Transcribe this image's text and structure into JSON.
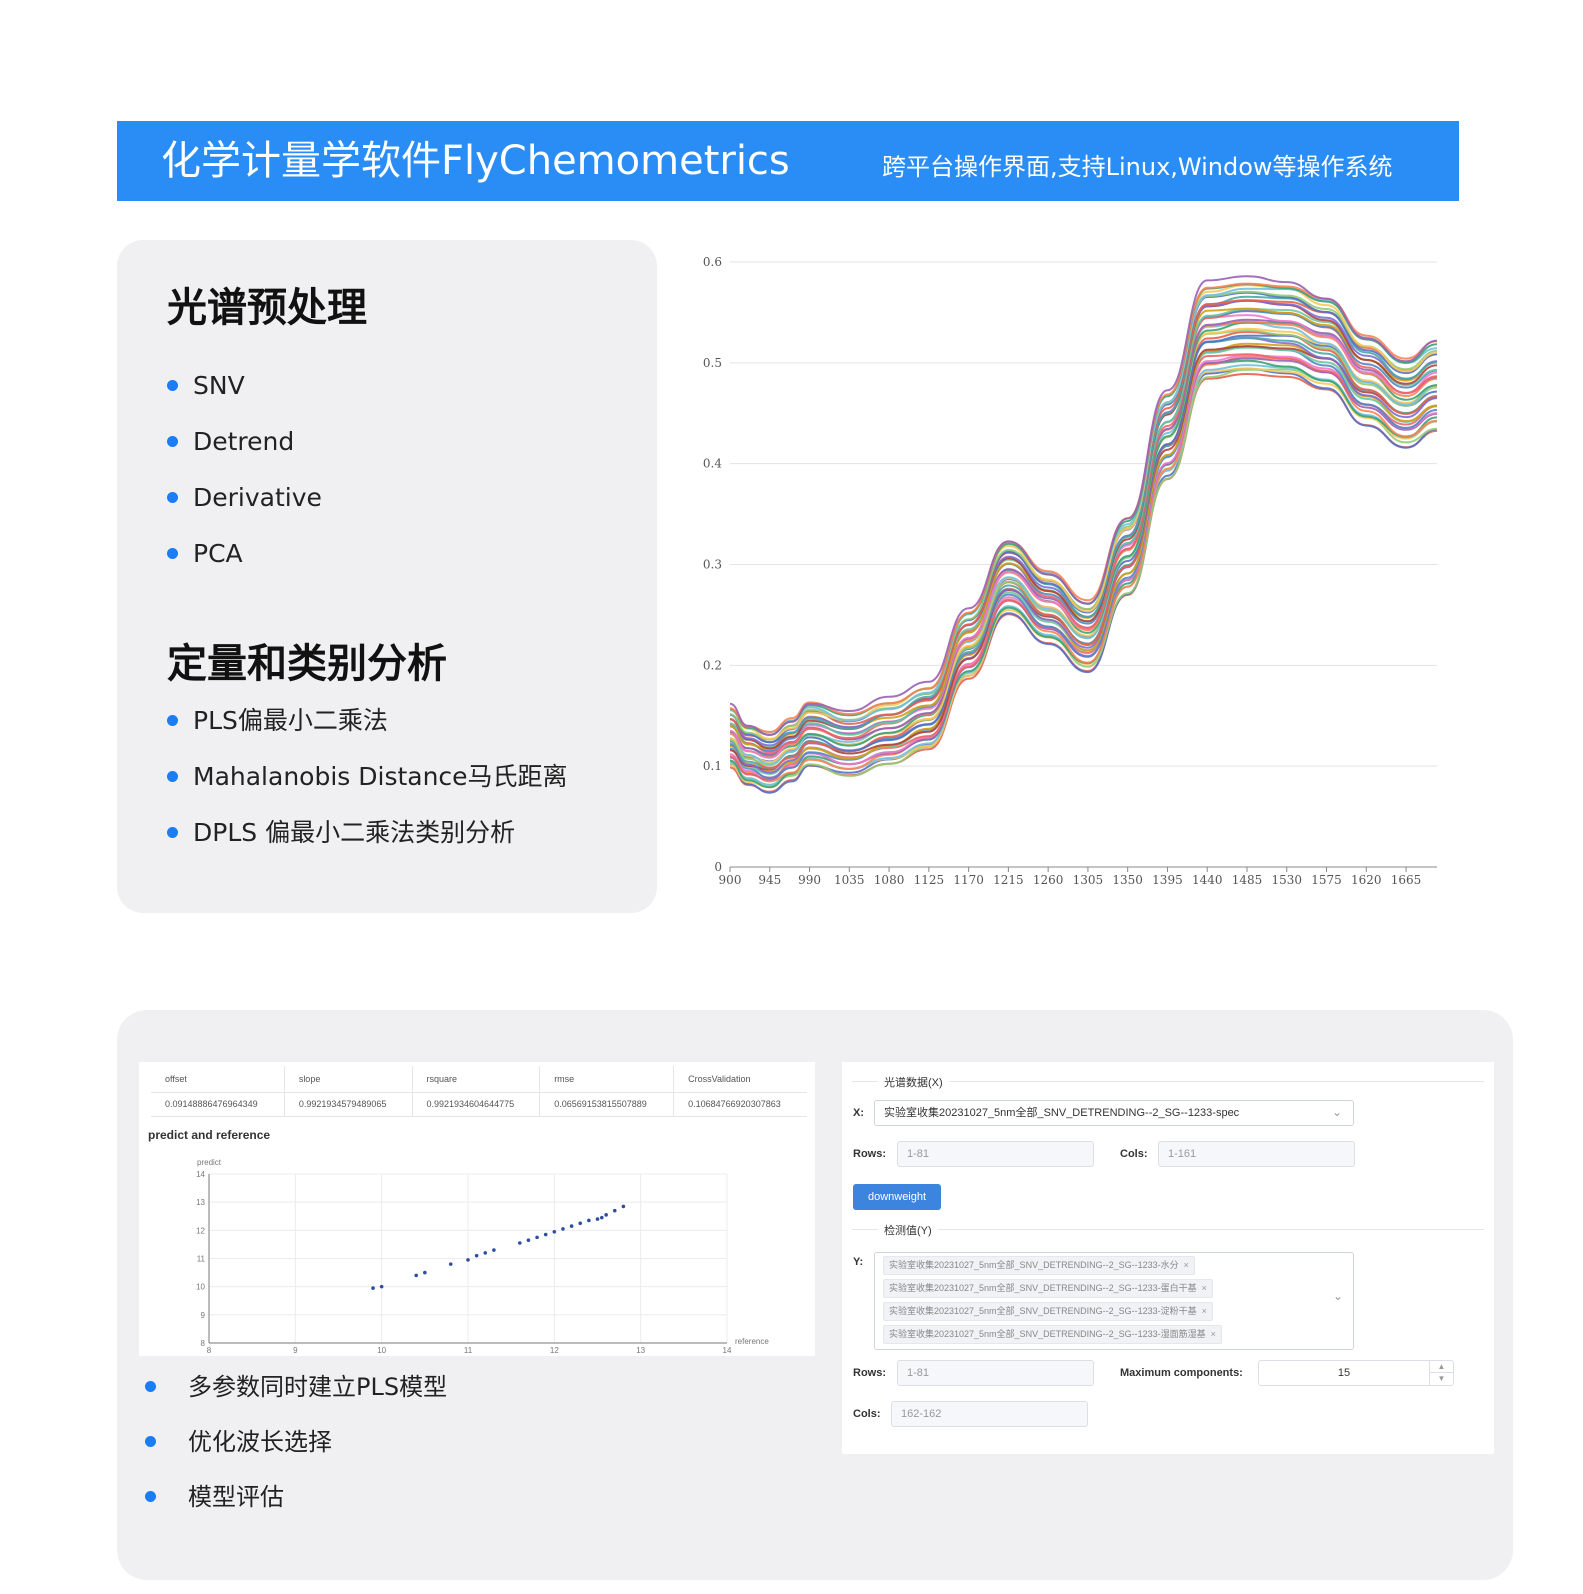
{
  "banner": {
    "title": "化学计量学软件FlyChemometrics",
    "subtitle": "跨平台操作界面,支持Linux,Window等操作系统"
  },
  "preprocessing": {
    "title": "光谱预处理",
    "items": [
      "SNV",
      "Detrend",
      "Derivative",
      "PCA"
    ]
  },
  "analysis": {
    "title": "定量和类别分析",
    "items": [
      "PLS偏最小二乘法",
      "Mahalanobis Distance马氏距离",
      "DPLS 偏最小二乘法类别分析"
    ]
  },
  "chart_data": [
    {
      "type": "line",
      "title": "",
      "xlabel": "",
      "ylabel": "",
      "x_ticks": [
        900,
        945,
        990,
        1035,
        1080,
        1125,
        1170,
        1215,
        1260,
        1305,
        1350,
        1395,
        1440,
        1485,
        1530,
        1575,
        1620,
        1665
      ],
      "y_ticks": [
        0,
        0.1,
        0.2,
        0.3,
        0.4,
        0.5,
        0.6
      ],
      "xlim": [
        900,
        1700
      ],
      "ylim": [
        0,
        0.6
      ],
      "grid": "horizontal",
      "x": [
        900,
        920,
        945,
        970,
        990,
        1035,
        1080,
        1125,
        1170,
        1215,
        1260,
        1305,
        1350,
        1395,
        1440,
        1485,
        1530,
        1575,
        1620,
        1665,
        1700
      ],
      "base_profile": [
        0.133,
        0.115,
        0.108,
        0.12,
        0.135,
        0.125,
        0.137,
        0.152,
        0.225,
        0.292,
        0.262,
        0.233,
        0.312,
        0.432,
        0.536,
        0.541,
        0.538,
        0.525,
        0.488,
        0.465,
        0.482
      ],
      "series_count": 40,
      "series_spread": [
        -0.052,
        0.042
      ],
      "series_colors": [
        "#e8604c",
        "#5470c6",
        "#91cc75",
        "#fac858",
        "#73c0de",
        "#3ba272",
        "#fc8452",
        "#9a60b4",
        "#ea7ccc",
        "#ee6666",
        "#4f88c8",
        "#6dc8a0",
        "#d4a017",
        "#b0413e",
        "#7b6ed6",
        "#48a9a6"
      ]
    },
    {
      "type": "scatter",
      "title": "predict and reference",
      "xlabel": "reference",
      "ylabel": "predict",
      "xlim": [
        8,
        14
      ],
      "ylim": [
        8,
        14
      ],
      "x_ticks": [
        8,
        9,
        10,
        11,
        12,
        13,
        14
      ],
      "y_ticks": [
        8,
        9,
        10,
        11,
        12,
        13,
        14
      ],
      "x": [
        9.9,
        10.0,
        10.4,
        10.5,
        10.8,
        11.0,
        11.1,
        11.2,
        11.3,
        11.6,
        11.7,
        11.8,
        11.9,
        12.0,
        12.1,
        12.2,
        12.3,
        12.4,
        12.5,
        12.55,
        12.6,
        12.7,
        12.8
      ],
      "y": [
        9.95,
        10.0,
        10.4,
        10.5,
        10.8,
        10.95,
        11.1,
        11.2,
        11.3,
        11.55,
        11.65,
        11.75,
        11.85,
        11.95,
        12.05,
        12.15,
        12.25,
        12.35,
        12.4,
        12.45,
        12.55,
        12.7,
        12.85
      ],
      "point_color": "#2f4ea0"
    }
  ],
  "metrics": {
    "headers": [
      "offset",
      "slope",
      "rsquare",
      "rmse",
      "CrossValidation"
    ],
    "values": [
      "0.09148886476964349",
      "0.9921934579489065",
      "0.9921934604644775",
      "0.06569153815507889",
      "0.10684766920307863"
    ]
  },
  "form": {
    "x_section": "光谱数据(X)",
    "x_label": "X:",
    "x_value": "实验室收集20231027_5nm全部_SNV_DETRENDING--2_SG--1233-spec",
    "rows_label": "Rows:",
    "rows_value": "1-81",
    "cols_label": "Cols:",
    "cols_value": "1-161",
    "button": "downweight",
    "y_section": "检测值(Y)",
    "y_label": "Y:",
    "y_tags": [
      "实验室收集20231027_5nm全部_SNV_DETRENDING--2_SG--1233-水分",
      "实验室收集20231027_5nm全部_SNV_DETRENDING--2_SG--1233-蛋白干基",
      "实验室收集20231027_5nm全部_SNV_DETRENDING--2_SG--1233-淀粉干基",
      "实验室收集20231027_5nm全部_SNV_DETRENDING--2_SG--1233-湿面筋湿基"
    ],
    "rows2_label": "Rows:",
    "rows2_value": "1-81",
    "maxcomp_label": "Maximum components:",
    "maxcomp_value": "15",
    "cols2_label": "Cols:",
    "cols2_value": "162-162"
  },
  "bottom_features": [
    "多参数同时建立PLS模型",
    "优化波长选择",
    "模型评估"
  ]
}
